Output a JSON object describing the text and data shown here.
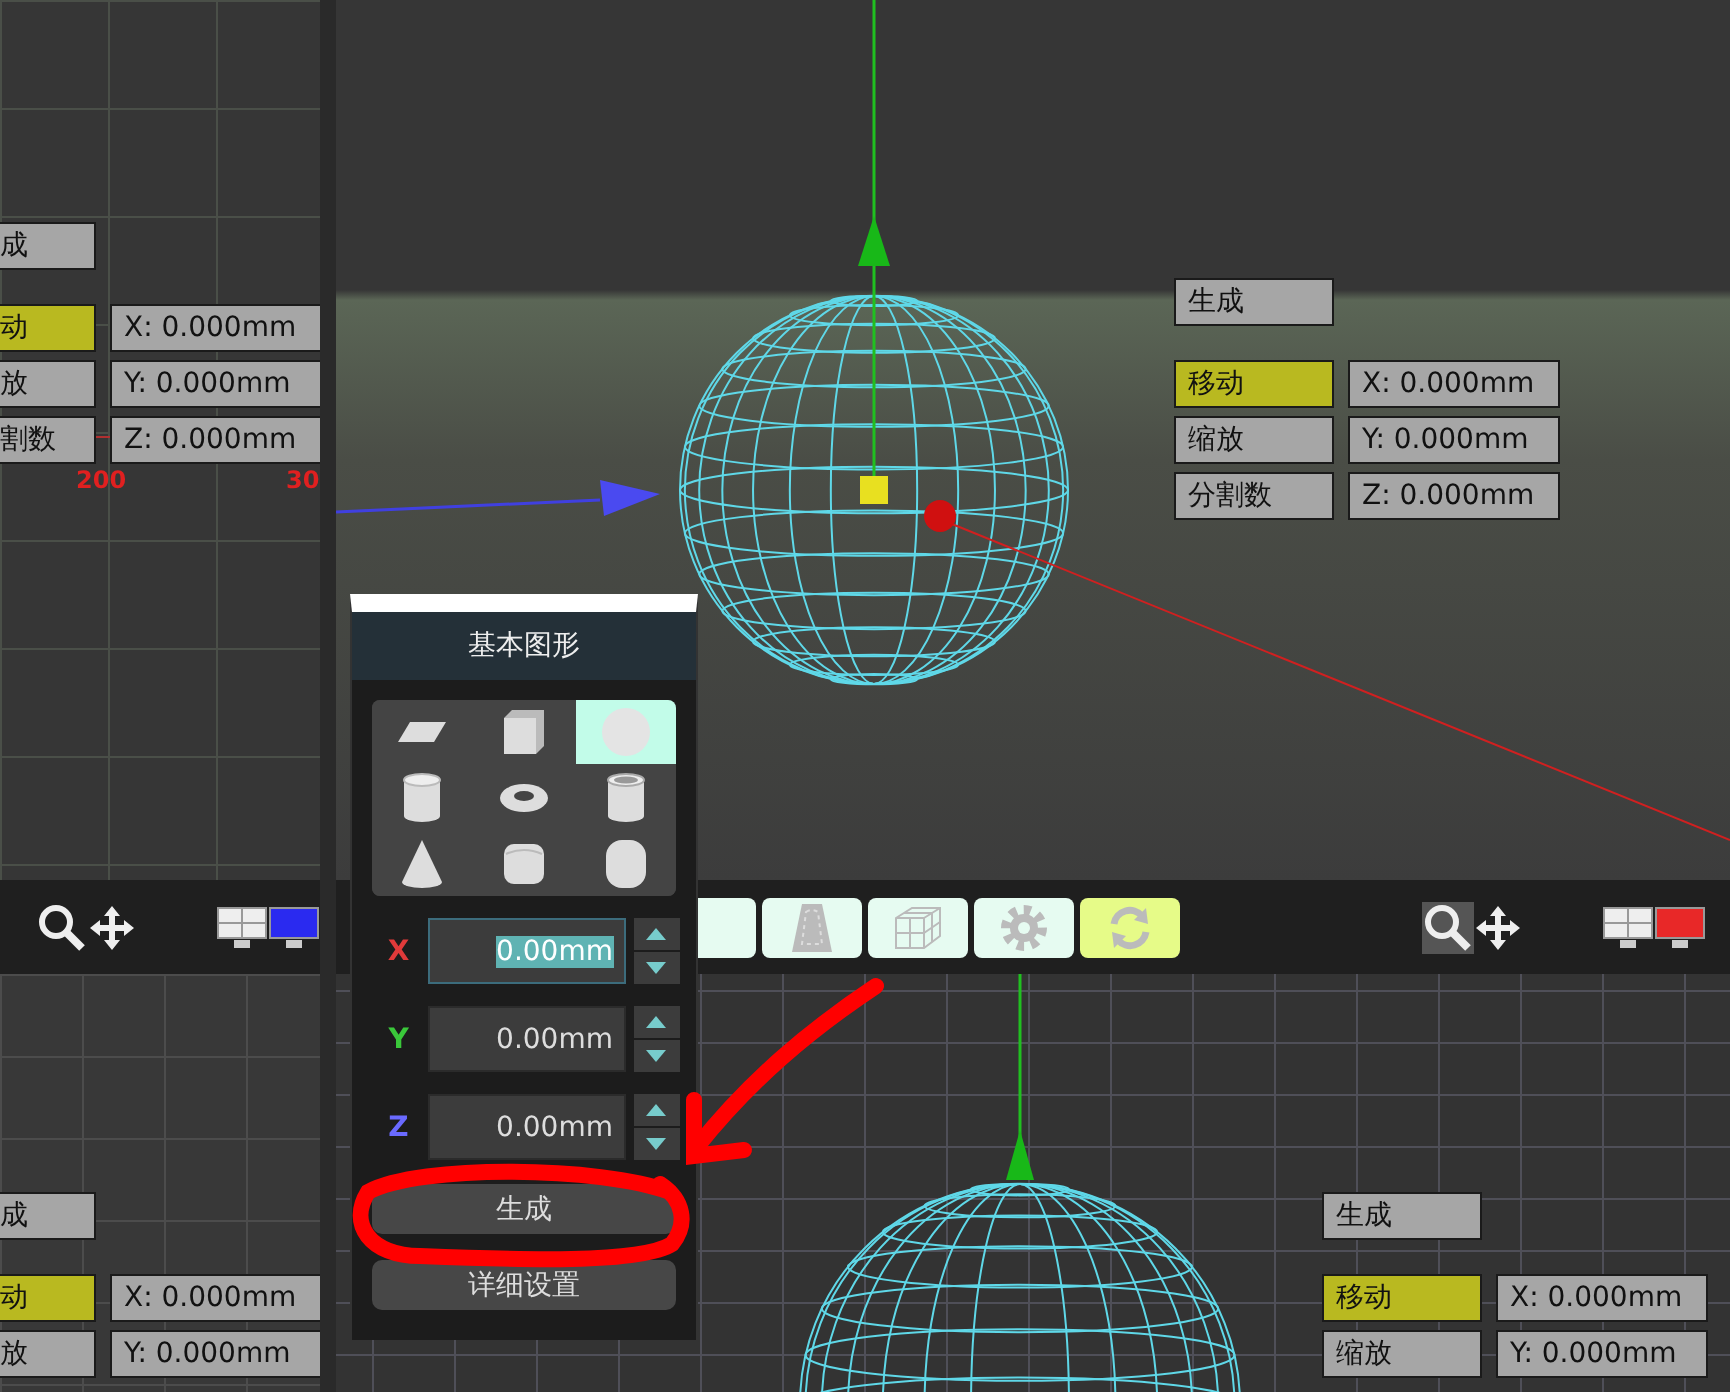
{
  "viewports": [
    {
      "generate": "成",
      "modes": [
        {
          "label": "动",
          "selected": true,
          "coord": "X: 0.000mm"
        },
        {
          "label": "放",
          "selected": false,
          "coord": "Y: 0.000mm"
        },
        {
          "label": "割数",
          "selected": false,
          "coord": "Z: 0.000mm"
        }
      ],
      "axis_labels": [
        "200",
        "30"
      ]
    },
    {
      "generate": "生成",
      "modes": [
        {
          "label": "移动",
          "selected": true,
          "coord": "X: 0.000mm"
        },
        {
          "label": "缩放",
          "selected": false,
          "coord": "Y: 0.000mm"
        },
        {
          "label": "分割数",
          "selected": false,
          "coord": "Z: 0.000mm"
        }
      ]
    },
    {
      "generate": "成",
      "modes": [
        {
          "label": "动",
          "selected": true,
          "coord": "X: 0.000mm"
        },
        {
          "label": "放",
          "selected": false,
          "coord": "Y: 0.000mm"
        }
      ]
    },
    {
      "generate": "生成",
      "modes": [
        {
          "label": "移动",
          "selected": true,
          "coord": "X: 0.000mm"
        },
        {
          "label": "缩放",
          "selected": false,
          "coord": "Y: 0.000mm"
        }
      ]
    }
  ],
  "view_controls": [
    {
      "zoom_selected": false,
      "color": "#2a2af0"
    },
    {
      "zoom_selected": true,
      "color": "#e82828"
    }
  ],
  "tools": [
    {
      "kind": "blank",
      "selected": false
    },
    {
      "kind": "trapezoid",
      "selected": false
    },
    {
      "kind": "cube-grid",
      "selected": false
    },
    {
      "kind": "gear",
      "selected": false
    },
    {
      "kind": "refresh",
      "selected": true
    }
  ],
  "shape_panel": {
    "title": "基本图形",
    "shapes": [
      {
        "kind": "plane",
        "selected": false
      },
      {
        "kind": "cube",
        "selected": false
      },
      {
        "kind": "sphere",
        "selected": true
      },
      {
        "kind": "cylinder",
        "selected": false
      },
      {
        "kind": "torus",
        "selected": false
      },
      {
        "kind": "tube",
        "selected": false
      },
      {
        "kind": "cone",
        "selected": false
      },
      {
        "kind": "rounded-cube",
        "selected": false
      },
      {
        "kind": "capsule",
        "selected": false
      }
    ],
    "fields": [
      {
        "axis": "X",
        "color": "#e03a3a",
        "value": "0.00mm",
        "selected": true
      },
      {
        "axis": "Y",
        "color": "#3ac83a",
        "value": "0.00mm",
        "selected": false
      },
      {
        "axis": "Z",
        "color": "#6a6aff",
        "value": "0.00mm",
        "selected": false
      }
    ],
    "buttons": [
      "生成",
      "详细设置"
    ]
  }
}
